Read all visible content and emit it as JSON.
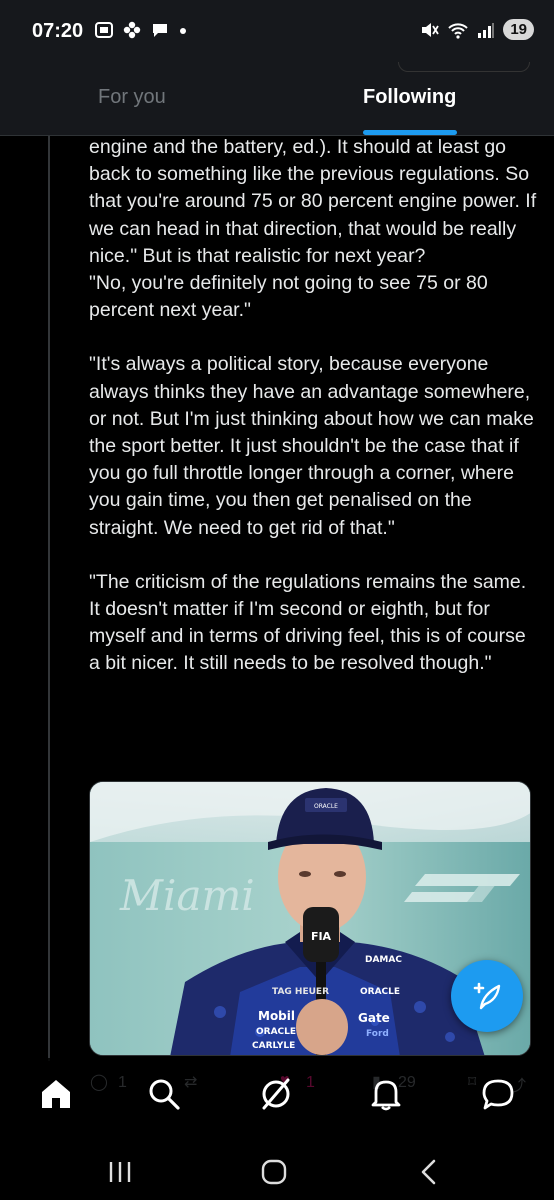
{
  "status_bar": {
    "time": "07:20",
    "battery": "19"
  },
  "header": {
    "tabs": [
      {
        "label": "For you",
        "selected": false
      },
      {
        "label": "Following",
        "selected": true
      }
    ]
  },
  "tweet": {
    "paragraphs": [
      "engine and the battery, ed.). It should at least go back to something like the previous regulations. So that you're around 75 or 80 percent engine power. If we can head in that direction, that would be really nice.\" But is that realistic for next year?\n\"No, you're definitely not going to see 75 or 80 percent next year.\"",
      "\"It's always a political story, because everyone always thinks they have an advantage somewhere, or not. But I'm just thinking about how we can make the sport better. It just shouldn't be the case that if you go full throttle longer through a corner, where you gain time, you then get penalised on the straight. We need to get rid of that.\"",
      "\"The criticism of the regulations remains the same. It doesn't matter if I'm second or eighth, but for myself and in terms of driving feel, this is of course a bit nicer. It still needs to be resolved though.\""
    ],
    "media": {
      "backdrop_text": "Miami",
      "cap_text": "ORACLE",
      "mic_text": "FIA",
      "sponsors": [
        "TAG HEUER",
        "Mobil",
        "ORACLE",
        "CARLYLE",
        "ORACLE",
        "Gate",
        "Ford",
        "DAMAC"
      ]
    },
    "actions": {
      "replies": "1",
      "likes": "1",
      "views": "29"
    }
  },
  "colors": {
    "accent": "#1d9bf0",
    "background": "#000000",
    "text": "#e7e9ea",
    "muted": "#71767b"
  }
}
